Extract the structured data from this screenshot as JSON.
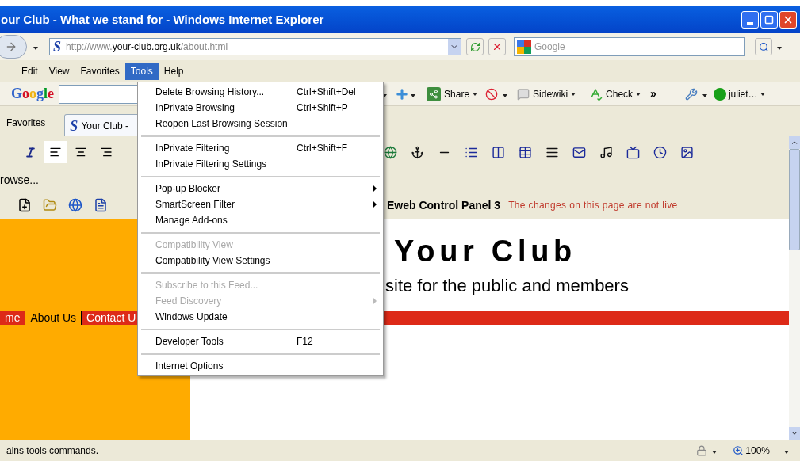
{
  "window": {
    "title": "our Club - What we stand for - Windows Internet Explorer"
  },
  "address_bar": {
    "site_icon": "S",
    "url": {
      "prefix": "http://www.",
      "host": "your-club.org.uk",
      "path": "/about.html"
    }
  },
  "search": {
    "placeholder": "Google"
  },
  "menu_bar": [
    {
      "label": "Edit",
      "selected": false
    },
    {
      "label": "View",
      "selected": false
    },
    {
      "label": "Favorites",
      "selected": false
    },
    {
      "label": "Tools",
      "selected": true
    },
    {
      "label": "Help",
      "selected": false
    }
  ],
  "google_toolbar": {
    "logo": "Google",
    "share": "Share",
    "sidewiki": "Sidewiki",
    "check": "Check",
    "more": "»",
    "account": "juliet…"
  },
  "favorites_bar": {
    "favorites": "Favorites",
    "tab_icon": "S",
    "tab": "Your Club -"
  },
  "editor": {
    "browse": "rowse...",
    "panel_title": "Eweb Control Panel 3",
    "notice": "The changes on this page are not live"
  },
  "page": {
    "heading": "Your Club",
    "subtitle": "site for the public and members",
    "nav": [
      {
        "label": "me",
        "selected": false
      },
      {
        "label": "About Us",
        "selected": true
      },
      {
        "label": "Contact U",
        "selected": false
      }
    ]
  },
  "tools_menu": [
    {
      "kind": "item",
      "label": "Delete Browsing History...",
      "shortcut": "Ctrl+Shift+Del",
      "disabled": false,
      "submenu": false
    },
    {
      "kind": "item",
      "label": "InPrivate Browsing",
      "shortcut": "Ctrl+Shift+P",
      "disabled": false,
      "submenu": false
    },
    {
      "kind": "item",
      "label": "Reopen Last Browsing Session",
      "disabled": false,
      "submenu": false
    },
    {
      "kind": "separator"
    },
    {
      "kind": "item",
      "label": "InPrivate Filtering",
      "shortcut": "Ctrl+Shift+F",
      "disabled": false,
      "submenu": false
    },
    {
      "kind": "item",
      "label": "InPrivate Filtering Settings",
      "disabled": false,
      "submenu": false
    },
    {
      "kind": "separator"
    },
    {
      "kind": "item",
      "label": "Pop-up Blocker",
      "disabled": false,
      "submenu": true
    },
    {
      "kind": "item",
      "label": "SmartScreen Filter",
      "disabled": false,
      "submenu": true
    },
    {
      "kind": "item",
      "label": "Manage Add-ons",
      "disabled": false,
      "submenu": false
    },
    {
      "kind": "separator"
    },
    {
      "kind": "item",
      "label": "Compatibility View",
      "disabled": true,
      "submenu": false
    },
    {
      "kind": "item",
      "label": "Compatibility View Settings",
      "disabled": false,
      "submenu": false
    },
    {
      "kind": "separator"
    },
    {
      "kind": "item",
      "label": "Subscribe to this Feed...",
      "disabled": true,
      "submenu": false
    },
    {
      "kind": "item",
      "label": "Feed Discovery",
      "disabled": true,
      "submenu": true
    },
    {
      "kind": "item",
      "label": "Windows Update",
      "disabled": false,
      "submenu": false
    },
    {
      "kind": "separator"
    },
    {
      "kind": "item",
      "label": "Developer Tools",
      "shortcut": "F12",
      "disabled": false,
      "submenu": false
    },
    {
      "kind": "separator"
    },
    {
      "kind": "item",
      "label": "Internet Options",
      "disabled": false,
      "submenu": false
    }
  ],
  "status_bar": {
    "text": "ains tools commands.",
    "zoom": "100%"
  }
}
